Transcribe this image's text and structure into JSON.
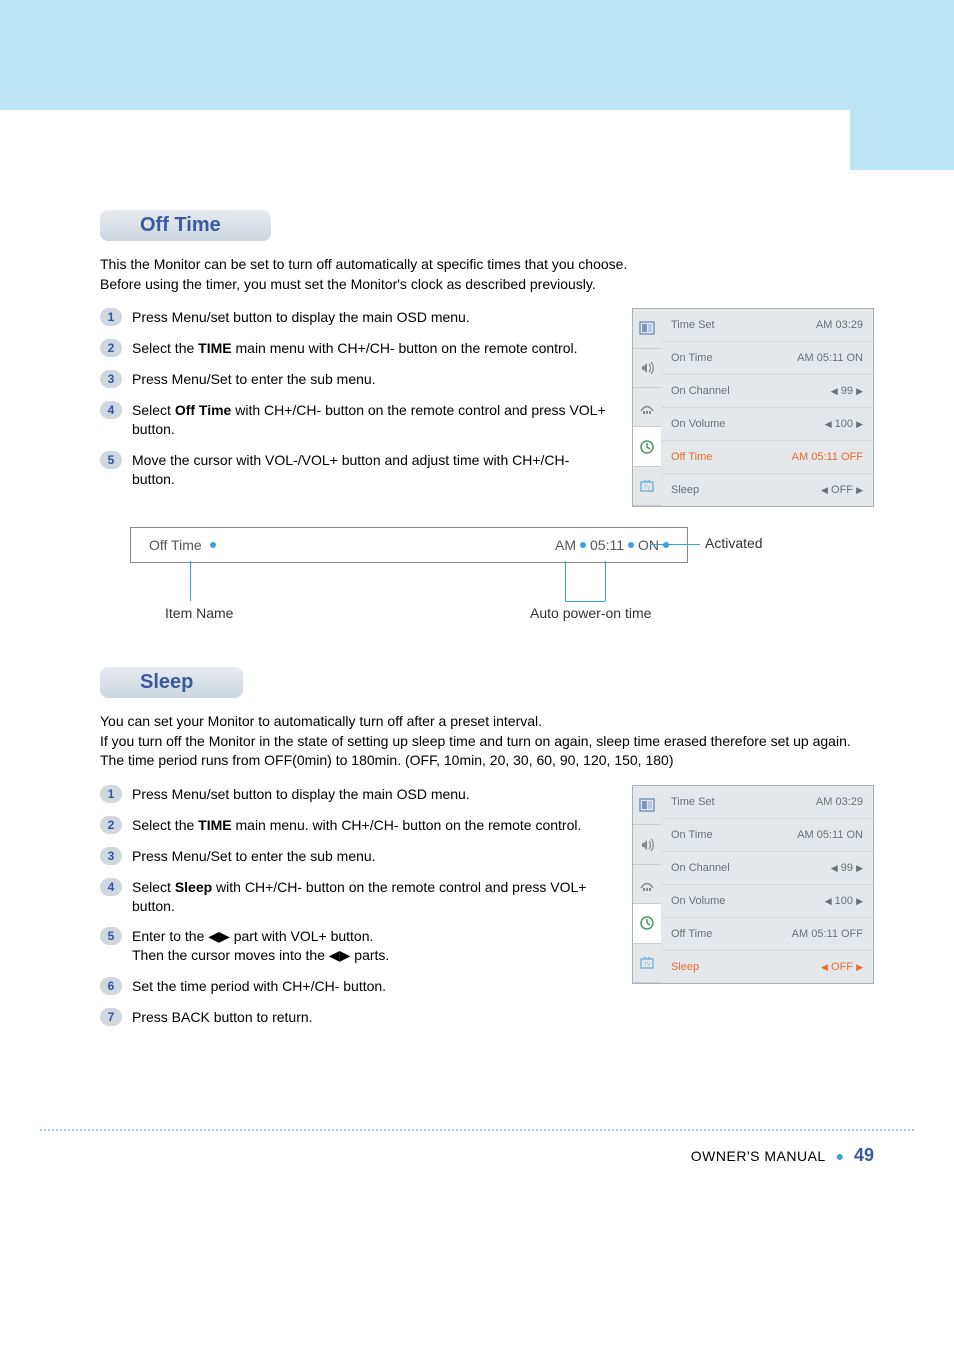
{
  "sections": {
    "off_time": {
      "title": "Off Time",
      "intro": "This the Monitor can be set to turn off automatically at specific times that you choose.\nBefore using the timer, you must set the Monitor's clock as described previously.",
      "steps": [
        "Press Menu/set button to display the main OSD menu.",
        "Select the <b>TIME</b> main menu with CH+/CH- button on the remote control.",
        "Press Menu/Set to enter the sub menu.",
        "Select <b>Off Time</b> with CH+/CH- button on the remote control and press VOL+ button.",
        "Move the cursor with VOL-/VOL+ button and adjust time with CH+/CH- button."
      ],
      "diagram": {
        "item_label": "Off Time",
        "value_parts": [
          "AM",
          "05:11",
          "ON"
        ],
        "item_name_label": "Item Name",
        "auto_label": "Auto power-on time",
        "activated_label": "Activated"
      }
    },
    "sleep": {
      "title": "Sleep",
      "intro": "You can set your Monitor to automatically turn off after a preset interval.\nIf you turn off the Monitor in the state of setting up sleep time and turn on again, sleep time erased therefore set up again. The time period runs from OFF(0min) to 180min. (OFF, 10min, 20, 30, 60, 90, 120, 150, 180)",
      "steps": [
        "Press Menu/set button to display the main OSD menu.",
        "Select the <b>TIME</b> main menu. with CH+/CH- button on the remote control.",
        "Press Menu/Set to enter the sub menu.",
        "Select <b>Sleep</b> with CH+/CH- button on the remote control and press VOL+ button.",
        "Enter to the ◀▶ part with VOL+ button.\nThen the cursor moves into the ◀▶ parts.",
        "Set the time period with CH+/CH- button.",
        "Press BACK button to return."
      ]
    }
  },
  "osd": {
    "rows": [
      {
        "label": "Time Set",
        "value": "AM 03:29"
      },
      {
        "label": "On Time",
        "value": "AM 05:11 ON"
      },
      {
        "label": "On Channel",
        "value": "◀ 99 ▶"
      },
      {
        "label": "On Volume",
        "value": "◀ 100 ▶"
      },
      {
        "label": "Off Time",
        "value": "AM 05:11 OFF"
      },
      {
        "label": "Sleep",
        "value": "◀ OFF ▶"
      }
    ],
    "highlight_off_time_index": 4,
    "highlight_sleep_index": 5
  },
  "footer": {
    "manual": "OWNER'S MANUAL",
    "page": "49"
  }
}
